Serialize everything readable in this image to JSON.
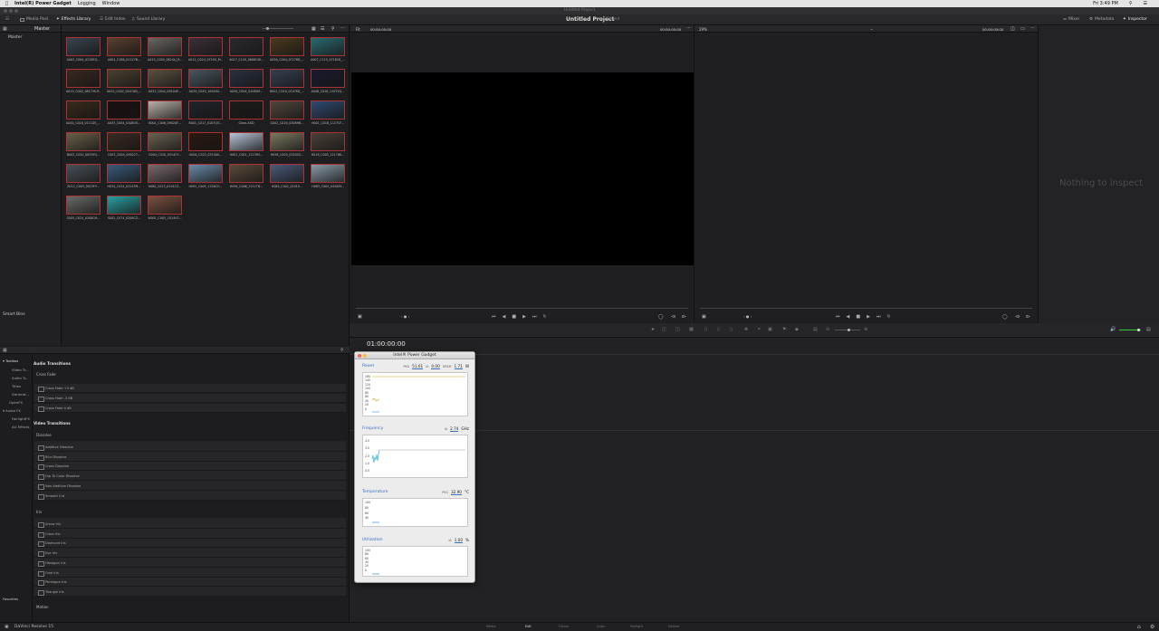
{
  "menubar": {
    "app_name": "Intel(R) Power Gadget",
    "items": [
      "Logging",
      "Window"
    ],
    "clock": "Fri 3:49 PM"
  },
  "window": {
    "title": "Untitled Project"
  },
  "toolbar": {
    "media_pool": "Media Pool",
    "effects_library": "Effects Library",
    "edit_index": "Edit Index",
    "sound_library": "Sound Library",
    "project_title": "Untitled Project",
    "project_status": "Edited",
    "mixer": "Mixer",
    "metadata": "Metadata",
    "inspector": "Inspector"
  },
  "bins": {
    "master": "Master",
    "smart_bins": "Smart Bins",
    "favorites": "Favorites"
  },
  "media_pool": {
    "title": "Master",
    "clips": [
      "A003_C064_0218EQ...",
      "A004_C186_01127B...",
      "A015_C005_0824LJ_R...",
      "A012_C024_0725X_M...",
      "A017_C105_0808OW...",
      "A056_C004_07278D_...",
      "A007_C115_071818_...",
      "A019_C002_0817VK.R...",
      "A020_C002_0107AN_...",
      "A025_C004_09104E...",
      "A029_C049_10040U...",
      "A030_C004_01080H...",
      "B001_C010_0107K8_...",
      "A048_C016_1107VQ...",
      "A044_C018_0111D5_...",
      "A033_C004_0108OE...",
      "B001_C006_0902AF...",
      "B001_C017_0107QO...",
      "Glass.XXD",
      "G002_C016_0308HB...",
      "H001_C018_1127CF...",
      "B003_C020_0629YQ...",
      "C003_C004_090227...",
      "G004_C010_0314CY...",
      "G004_C023_0315A0...",
      "H001_C001_1213H5...",
      "H058_C003_0320CS...",
      "H018_C005_12178K...",
      "Z012_C003_0923FV...",
      "H034_C024_0314FM...",
      "H080_C013_0101CZ...",
      "H092_C009_1126CO...",
      "H094_C006_1211TB...",
      "H084_C002_01010...",
      "H083_C005_0420AY...",
      "S005_C024_0208GH...",
      "S002_C074_0206CZ...",
      "W001_C005_1014V3..."
    ]
  },
  "viewer_source": {
    "fit": "Fit",
    "tc_left": "00:00:00:00",
    "tc_right": "00:00:00:00"
  },
  "viewer_timeline": {
    "zoom": "29%",
    "tc_right": "00:00:00:00"
  },
  "inspector_panel": {
    "empty": "Nothing to inspect"
  },
  "effects_tree": {
    "toolbox": "Toolbox",
    "video_transitions": "Video Tr...",
    "audio_transitions": "Audio Tr...",
    "titles": "Titles",
    "generators": "Generat...",
    "openfx": "OpenFX",
    "audio_fx": "Audio FX",
    "fairlight": "FairlightFX",
    "all_effects": "AU Effects"
  },
  "effects_list": {
    "audio_transitions": "Audio Transitions",
    "cross_fade": "Cross Fade",
    "audio_items": [
      "Cross Fade +3 dB",
      "Cross Fade -3 dB",
      "Cross Fade 0 dB"
    ],
    "video_transitions": "Video Transitions",
    "dissolve": "Dissolve",
    "dissolve_items": [
      "Additive Dissolve",
      "Blur Dissolve",
      "Cross Dissolve",
      "Dip To Color Dissolve",
      "Non-Additive Dissolve",
      "Smooth Cut"
    ],
    "iris": "Iris",
    "iris_items": [
      "Arrow Iris",
      "Cross Iris",
      "Diamond Iris",
      "Eye Iris",
      "Hexagon Iris",
      "Oval Iris",
      "Pentagon Iris",
      "Triangle Iris"
    ],
    "motion": "Motion"
  },
  "timeline": {
    "timecode": "01:00:00:00"
  },
  "page_bar": {
    "brand": "DaVinci Resolve 15",
    "tabs": [
      "Media",
      "Edit",
      "Fusion",
      "Color",
      "Fairlight",
      "Deliver"
    ]
  },
  "power_gadget": {
    "title": "Intel® Power Gadget",
    "power": {
      "label": "Power",
      "pkg_label": "PKG",
      "pkg_value": "51.61",
      "ia_label": "IA",
      "ia_value": "0.00",
      "dram_label": "DRAM",
      "dram_value": "1.71",
      "unit": "W",
      "ticks": [
        "160",
        "140",
        "120",
        "100",
        "80",
        "60",
        "40",
        "20",
        "0"
      ]
    },
    "frequency": {
      "label": "Frequency",
      "ia_label": "IA",
      "value": "2.74",
      "unit": "GHz",
      "ticks": [
        "4.0",
        "3.0",
        "2.0",
        "1.0",
        "0.0"
      ]
    },
    "temperature": {
      "label": "Temperature",
      "pkg_label": "PKG",
      "value": "32.90",
      "unit": "°C",
      "ticks": [
        "100",
        "80",
        "60",
        "40"
      ]
    },
    "utilization": {
      "label": "Utilization",
      "ia_label": "IA",
      "value": "1.00",
      "unit": "%",
      "ticks": [
        "100",
        "80",
        "60",
        "40",
        "20",
        "0"
      ]
    }
  }
}
